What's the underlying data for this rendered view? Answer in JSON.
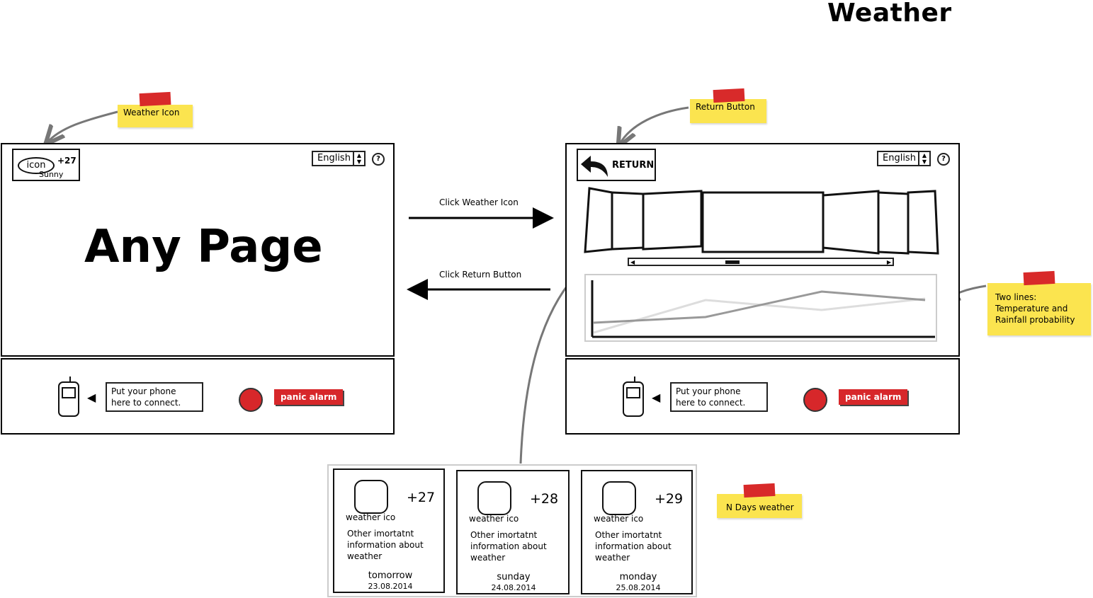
{
  "title": "Weather",
  "left_screen": {
    "weather_widget": {
      "icon_label": "icon",
      "temperature": "+27",
      "condition": "Sunny"
    },
    "language": "English",
    "help": "?",
    "page_label": "Any Page"
  },
  "right_screen": {
    "return_label": "RETURN",
    "language": "English",
    "help": "?"
  },
  "footer": {
    "phone_text": "Put your phone here to connect.",
    "panic_label": "panic alarm"
  },
  "arrows": {
    "forward_label": "Click Weather Icon",
    "back_label": "Click Return Button"
  },
  "notes": {
    "weather_icon": "Weather Icon",
    "return_button": "Return Button",
    "two_lines": "Two lines: Temperature and Rainfall probability",
    "n_days": "N Days weather"
  },
  "forecast_cards": [
    {
      "temp": "+27",
      "icon_label": "weather ico",
      "info": "Other imortatnt information about weather",
      "day": "tomorrow",
      "date": "23.08.2014"
    },
    {
      "temp": "+28",
      "icon_label": "weather ico",
      "info": "Other imortatnt information about weather",
      "day": "sunday",
      "date": "24.08.2014"
    },
    {
      "temp": "+29",
      "icon_label": "weather ico",
      "info": "Other imortatnt information about weather",
      "day": "monday",
      "date": "25.08.2014"
    }
  ],
  "colors": {
    "note_yellow": "#fbe44f",
    "tape_red": "#d82a2a",
    "panic_red": "#d7272a"
  }
}
